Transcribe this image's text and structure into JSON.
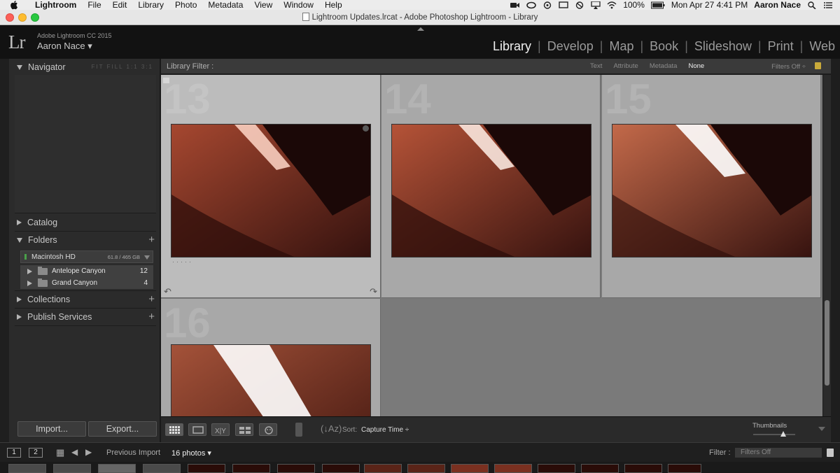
{
  "menubar": {
    "app": "Lightroom",
    "items": [
      "File",
      "Edit",
      "Library",
      "Photo",
      "Metadata",
      "View",
      "Window",
      "Help"
    ],
    "battery": "100%",
    "datetime": "Mon Apr 27  4:41 PM",
    "user": "Aaron Nace"
  },
  "window": {
    "title": "Lightroom Updates.lrcat - Adobe Photoshop Lightroom - Library"
  },
  "identity": {
    "logo": "Lr",
    "product": "Adobe Lightroom CC 2015",
    "user": "Aaron Nace"
  },
  "modules": [
    "Library",
    "Develop",
    "Map",
    "Book",
    "Slideshow",
    "Print",
    "Web"
  ],
  "left_panel": {
    "navigator": "Navigator",
    "catalog": "Catalog",
    "folders": "Folders",
    "volume": {
      "name": "Macintosh HD",
      "size": "61.8 / 465 GB"
    },
    "folder_items": [
      {
        "name": "Antelope Canyon",
        "count": "12"
      },
      {
        "name": "Grand Canyon",
        "count": "4"
      }
    ],
    "collections": "Collections",
    "publish_services": "Publish Services",
    "import_label": "Import...",
    "export_label": "Export..."
  },
  "filter_bar": {
    "label": "Library Filter :",
    "tabs": [
      "Text",
      "Attribute",
      "Metadata",
      "None"
    ],
    "selected": "None",
    "status": "Filters Off"
  },
  "grid": {
    "cells": [
      {
        "number": "13"
      },
      {
        "number": "14"
      },
      {
        "number": "15"
      },
      {
        "number": "16"
      }
    ]
  },
  "toolbar": {
    "sort_label": "Sort:",
    "sort_value": "Capture Time",
    "thumbnails_label": "Thumbnails",
    "thumbnail_size_level": 0.72
  },
  "filmstrip_bar": {
    "monitor1": "1",
    "monitor2": "2",
    "source": "Previous Import",
    "count": "16 photos",
    "filter_label": "Filter :",
    "filter_value": "Filters Off"
  },
  "colors": {
    "accent_lock": "#c8a93a",
    "grid_bg": "#7a7a7a",
    "selected_cell": "#bcbcbc"
  }
}
